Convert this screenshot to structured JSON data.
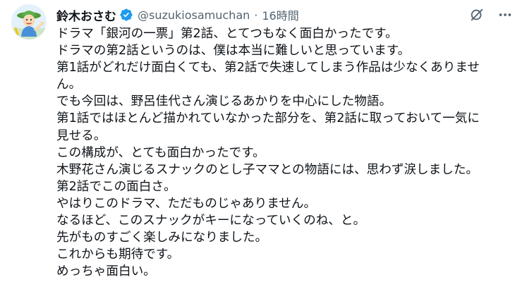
{
  "author": {
    "name": "鈴木おさむ",
    "handle": "@suzukiosamuchan",
    "separator": "·",
    "time": "16時間"
  },
  "icons": {
    "verified": "verified-badge-icon",
    "grok": "grok-icon",
    "more": "more-options-icon",
    "avatar": "avatar-illustration"
  },
  "colors": {
    "verified": "#1d9bf0",
    "secondary_text": "#536471",
    "primary_text": "#0f1419"
  },
  "post": {
    "lines": [
      "ドラマ「銀河の一票」第2話、とてつもなく面白かったです。",
      "ドラマの第2話というのは、僕は本当に難しいと思っています。",
      "第1話がどれだけ面白くても、第2話で失速してしまう作品は少なくありませ",
      "ん。",
      "でも今回は、野呂佳代さん演じるあかりを中心にした物語。",
      "第1話ではほとんど描かれていなかった部分を、第2話に取っておいて一気に",
      "見せる。",
      "この構成が、とても面白かったです。",
      "木野花さん演じるスナックのとし子ママとの物語には、思わず涙しました。",
      "第2話でこの面白さ。",
      "やはりこのドラマ、ただものじゃありません。",
      "なるほど、このスナックがキーになっていくのね、と。",
      "先がものすごく楽しみになりました。",
      "これからも期待です。",
      "めっちゃ面白い。"
    ]
  }
}
